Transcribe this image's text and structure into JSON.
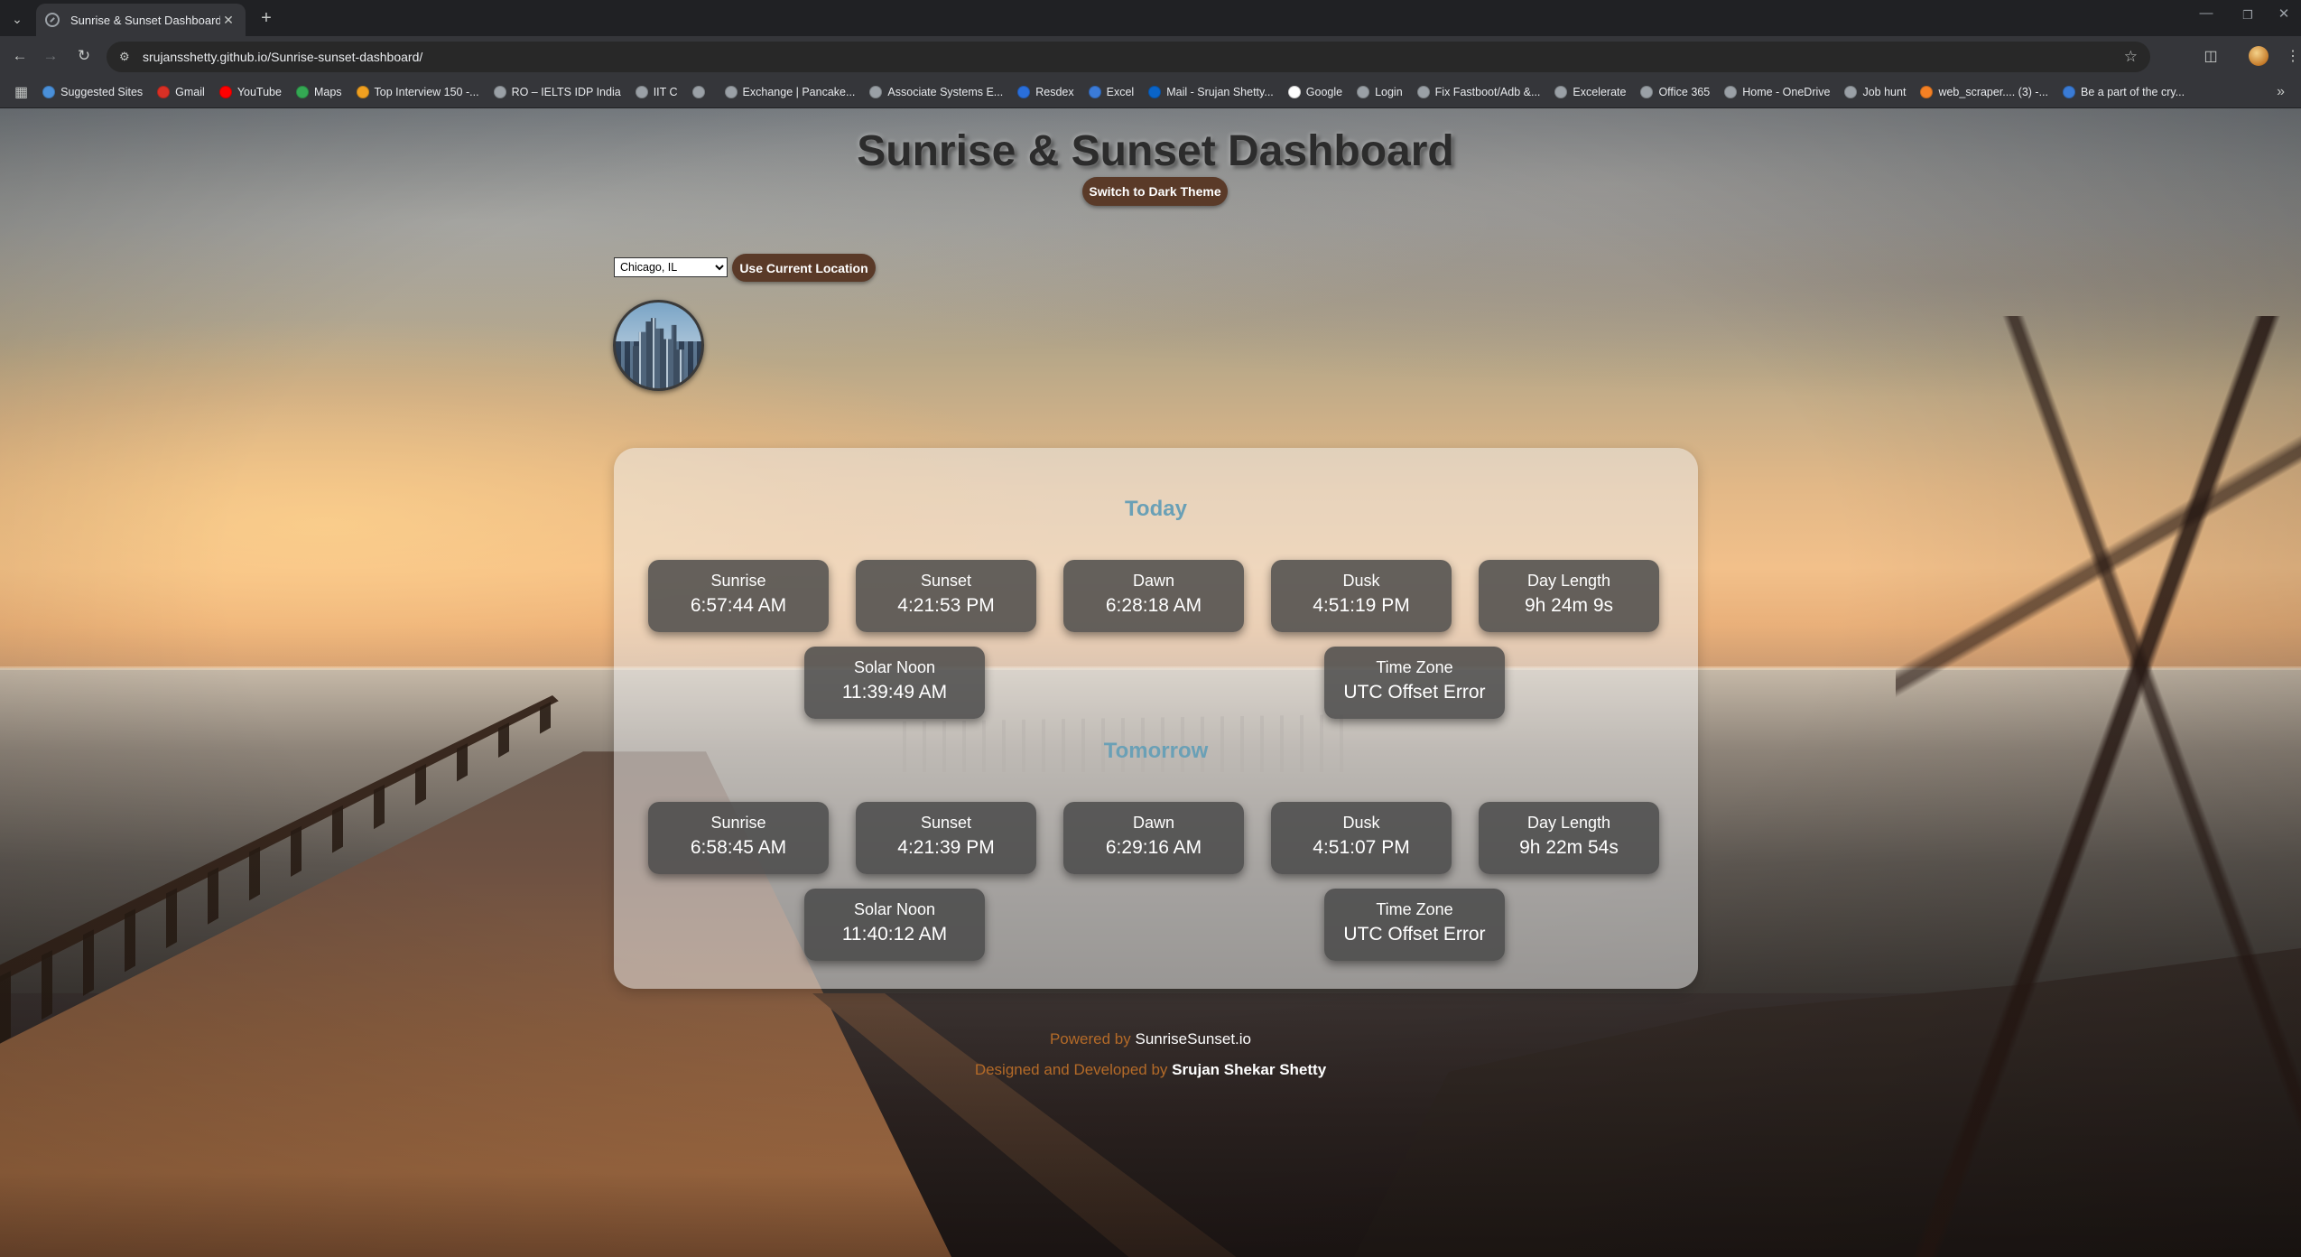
{
  "browser": {
    "tab_title": "Sunrise & Sunset Dashboard",
    "url": "srujansshetty.github.io/Sunrise-sunset-dashboard/",
    "bookmarks": [
      {
        "label": "Suggested Sites",
        "color": "#4a90d9"
      },
      {
        "label": "Gmail",
        "color": "#d93025"
      },
      {
        "label": "YouTube",
        "color": "#ff0000"
      },
      {
        "label": "Maps",
        "color": "#34a853"
      },
      {
        "label": "Top Interview 150 -...",
        "color": "#f0a020"
      },
      {
        "label": "RO – IELTS IDP India",
        "color": "#9aa0a6"
      },
      {
        "label": "IIT C",
        "color": "#9aa0a6"
      },
      {
        "label": "",
        "color": "#9aa0a6"
      },
      {
        "label": "Exchange | Pancake...",
        "color": "#9aa0a6"
      },
      {
        "label": "Associate Systems E...",
        "color": "#9aa0a6"
      },
      {
        "label": "Resdex",
        "color": "#2a6fdb"
      },
      {
        "label": "Excel",
        "color": "#3b7bd8"
      },
      {
        "label": "Mail - Srujan Shetty...",
        "color": "#0a64c8"
      },
      {
        "label": "Google",
        "color": "#ffffff"
      },
      {
        "label": "Login",
        "color": "#9aa0a6"
      },
      {
        "label": "Fix Fastboot/Adb &...",
        "color": "#9aa0a6"
      },
      {
        "label": "Excelerate",
        "color": "#9aa0a6"
      },
      {
        "label": "Office 365",
        "color": "#9aa0a6"
      },
      {
        "label": "Home - OneDrive",
        "color": "#9aa0a6"
      },
      {
        "label": "Job hunt",
        "color": "#9aa0a6"
      },
      {
        "label": "web_scraper.... (3) -...",
        "color": "#f48024"
      },
      {
        "label": "Be a part of the cry...",
        "color": "#3a7bd5"
      }
    ]
  },
  "app": {
    "title": "Sunrise & Sunset Dashboard",
    "theme_button": "Switch to Dark Theme",
    "location_select": "Chicago, IL",
    "current_location_button": "Use Current Location"
  },
  "today": {
    "heading": "Today",
    "cards": [
      {
        "label": "Sunrise",
        "value": "6:57:44 AM"
      },
      {
        "label": "Sunset",
        "value": "4:21:53 PM"
      },
      {
        "label": "Dawn",
        "value": "6:28:18 AM"
      },
      {
        "label": "Dusk",
        "value": "4:51:19 PM"
      },
      {
        "label": "Day Length",
        "value": "9h 24m 9s"
      },
      {
        "label": "Solar Noon",
        "value": "11:39:49 AM"
      },
      {
        "label": "Time Zone",
        "value": "UTC Offset Error"
      }
    ]
  },
  "tomorrow": {
    "heading": "Tomorrow",
    "cards": [
      {
        "label": "Sunrise",
        "value": "6:58:45 AM"
      },
      {
        "label": "Sunset",
        "value": "4:21:39 PM"
      },
      {
        "label": "Dawn",
        "value": "6:29:16 AM"
      },
      {
        "label": "Dusk",
        "value": "4:51:07 PM"
      },
      {
        "label": "Day Length",
        "value": "9h 22m 54s"
      },
      {
        "label": "Solar Noon",
        "value": "11:40:12 AM"
      },
      {
        "label": "Time Zone",
        "value": "UTC Offset Error"
      }
    ]
  },
  "footer": {
    "powered_prefix": "Powered by",
    "powered_name": "SunriseSunset.io",
    "designed_prefix": "Designed and Developed by",
    "designer_name": "Srujan Shekar Shetty"
  }
}
